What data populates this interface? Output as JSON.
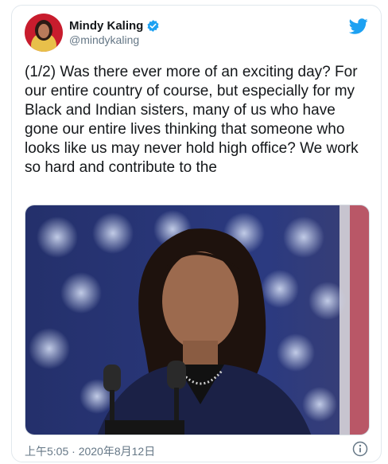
{
  "tweet": {
    "author": {
      "display_name": "Mindy Kaling",
      "handle": "@mindykaling",
      "verified": true,
      "verified_icon": "verified-badge-icon",
      "avatar_icon": "avatar"
    },
    "text": "(1/2) Was there ever more of an exciting day? For our entire country of course, but especially for my Black and Indian sisters, many of us who have gone our entire lives thinking that someone who looks like us may never hold high office? We work so hard and contribute to the",
    "media": {
      "kind": "photo",
      "icon": "photo-of-woman-speaking-at-microphones-before-american-flag"
    },
    "timestamp": "上午5:05 · 2020年8月12日",
    "platform_icon": "twitter-bird-icon",
    "info_icon": "info-icon"
  },
  "colors": {
    "brand_blue": "#1da1f2",
    "text_primary": "#14171a",
    "text_secondary": "#657786",
    "border": "#e1e8ed"
  }
}
